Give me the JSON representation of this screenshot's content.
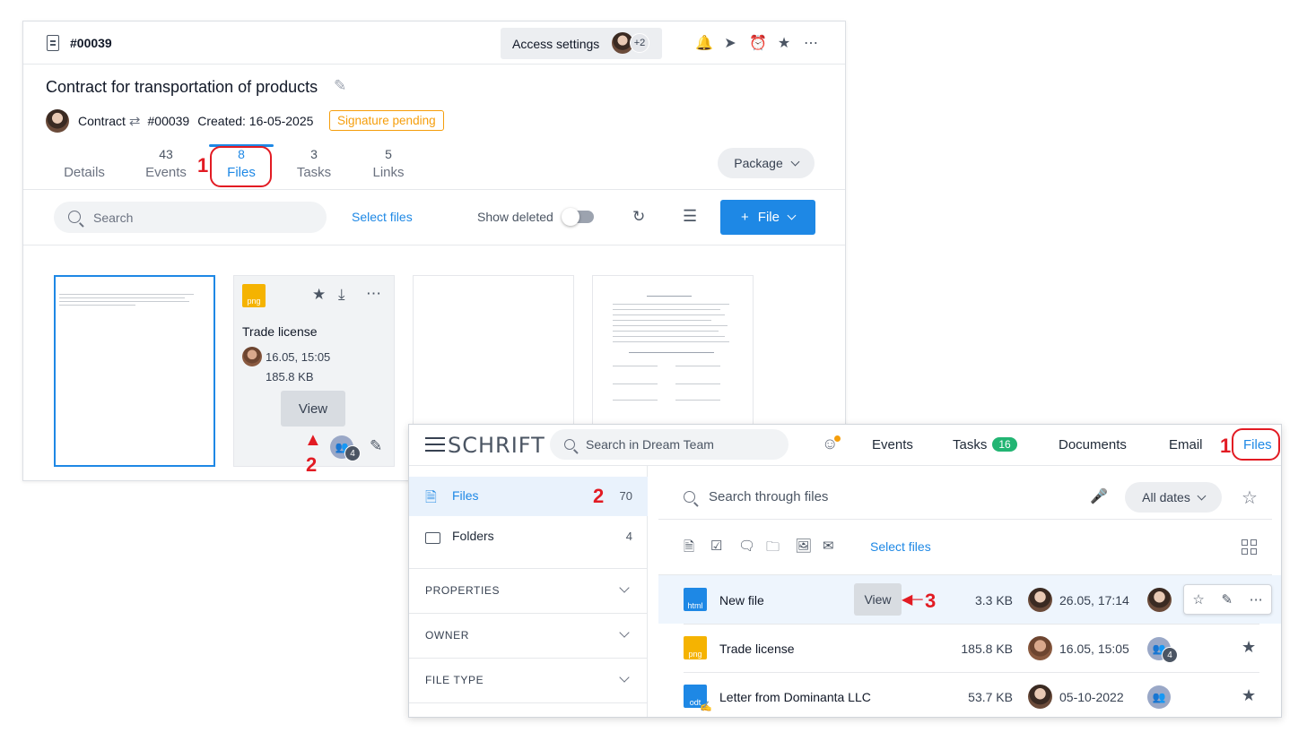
{
  "doc_panel": {
    "record_number": "#00039",
    "access_button": "Access settings",
    "access_extra": "+2",
    "title": "Contract for transportation of products",
    "meta_type": "Contract",
    "meta_number": "#00039",
    "meta_created": "Created: 16-05-2025",
    "status_badge": "Signature pending",
    "tabs": [
      {
        "count": "",
        "label": "Details"
      },
      {
        "count": "43",
        "label": "Events"
      },
      {
        "count": "8",
        "label": "Files"
      },
      {
        "count": "3",
        "label": "Tasks"
      },
      {
        "count": "5",
        "label": "Links"
      }
    ],
    "package_label": "Package",
    "search_placeholder": "Search",
    "select_files": "Select files",
    "show_deleted": "Show deleted",
    "file_button": "File",
    "card": {
      "icon_text": "png",
      "name": "Trade license",
      "date": "16.05, 15:05",
      "size": "185.8 KB",
      "view": "View",
      "group_count": "4"
    }
  },
  "annotations": {
    "tab_files": "1",
    "card_view": "2",
    "nav_files": "1",
    "sidebar_files": "2",
    "row_view": "3",
    "color": "#e21b23"
  },
  "app_panel": {
    "logo": "SCHRIFT",
    "search_placeholder": "Search in Dream Team",
    "nav": {
      "events": "Events",
      "tasks": "Tasks",
      "tasks_count": "16",
      "documents": "Documents",
      "email": "Email",
      "files": "Files"
    },
    "sidebar": {
      "files_label": "Files",
      "files_count": "70",
      "folders_label": "Folders",
      "folders_count": "4",
      "sections": [
        "PROPERTIES",
        "OWNER",
        "FILE TYPE"
      ]
    },
    "files_search_placeholder": "Search through files",
    "dates_label": "All dates",
    "select_files": "Select files",
    "rows": [
      {
        "icon": "html",
        "icon_color": "#1e88e5",
        "name": "New file",
        "view": "View",
        "size": "3.3 KB",
        "date": "26.05, 17:14"
      },
      {
        "icon": "png",
        "icon_color": "#f5b301",
        "name": "Trade license",
        "size": "185.8 KB",
        "date": "16.05, 15:05",
        "group_count": "4"
      },
      {
        "icon": "odt",
        "icon_color": "#1e88e5",
        "name": "Letter from Dominanta LLC",
        "size": "53.7 KB",
        "date": "05-10-2022"
      }
    ]
  },
  "colors": {
    "accent": "#1e88e5",
    "pending": "#f59e0b",
    "success": "#22b573"
  }
}
